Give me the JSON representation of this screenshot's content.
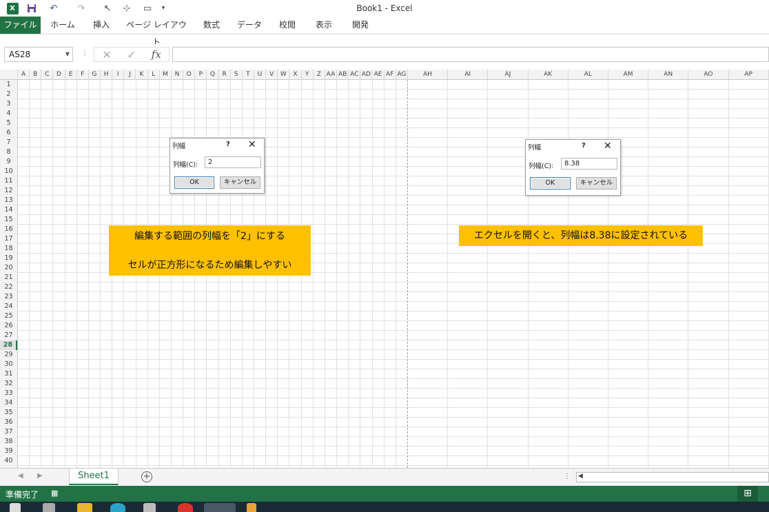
{
  "titlebar": {
    "title": "Book1 - Excel",
    "quick_access": [
      {
        "name": "excel-logo-icon",
        "glyph": "X"
      },
      {
        "name": "save-icon",
        "glyph": "💾"
      },
      {
        "name": "undo-icon",
        "glyph": "↶"
      },
      {
        "name": "redo-icon",
        "glyph": "↷"
      },
      {
        "name": "select-objects-icon",
        "glyph": "↖"
      },
      {
        "name": "touch-mode-icon",
        "glyph": "⊹"
      },
      {
        "name": "form-icon",
        "glyph": "▭"
      },
      {
        "name": "customize-qat-icon",
        "glyph": "▾"
      }
    ]
  },
  "ribbon": {
    "tabs": [
      "ファイル",
      "ホーム",
      "挿入",
      "ページ レイアウト",
      "数式",
      "データ",
      "校閲",
      "表示",
      "開発"
    ]
  },
  "formula_bar": {
    "name_box": "AS28",
    "formula": "",
    "cancel_icon": "✕",
    "enter_icon": "✓",
    "fx_label": "fx"
  },
  "grid": {
    "narrow_columns": [
      "A",
      "B",
      "C",
      "D",
      "E",
      "F",
      "G",
      "H",
      "I",
      "J",
      "K",
      "L",
      "M",
      "N",
      "O",
      "P",
      "Q",
      "R",
      "S",
      "T",
      "U",
      "V",
      "W",
      "X",
      "Y",
      "Z",
      "AA",
      "AB",
      "AC",
      "AD",
      "AE",
      "AF",
      "AG"
    ],
    "wide_columns": [
      "AH",
      "AI",
      "AJ",
      "AK",
      "AL",
      "AM",
      "AN",
      "AO",
      "AP"
    ],
    "rows": [
      "1",
      "2",
      "3",
      "4",
      "5",
      "6",
      "7",
      "8",
      "9",
      "10",
      "11",
      "12",
      "13",
      "14",
      "15",
      "16",
      "17",
      "18",
      "19",
      "20",
      "21",
      "22",
      "23",
      "24",
      "25",
      "26",
      "27",
      "28",
      "29",
      "30",
      "31",
      "32",
      "33",
      "34",
      "35",
      "36",
      "37",
      "38",
      "39",
      "40"
    ],
    "selected_row": "28"
  },
  "dialog_left": {
    "title": "列幅",
    "help": "?",
    "close": "✕",
    "label": "列幅(C):",
    "value": "2",
    "ok": "OK",
    "cancel": "キャンセル"
  },
  "dialog_right": {
    "title": "列幅",
    "help": "?",
    "close": "✕",
    "label": "列幅(C):",
    "value": "8.38",
    "ok": "OK",
    "cancel": "キャンセル"
  },
  "callout_left": {
    "line1": "編集する範囲の列幅を「2」にする",
    "line2": "セルが正方形になるため編集しやすい"
  },
  "callout_right": {
    "line1": "エクセルを開くと、列幅は8.38に設定されている"
  },
  "sheets": {
    "active": "Sheet1",
    "add": "⊕"
  },
  "status": {
    "ready": "準備完了"
  },
  "colors": {
    "excel_green": "#217346",
    "callout": "#ffc000"
  }
}
